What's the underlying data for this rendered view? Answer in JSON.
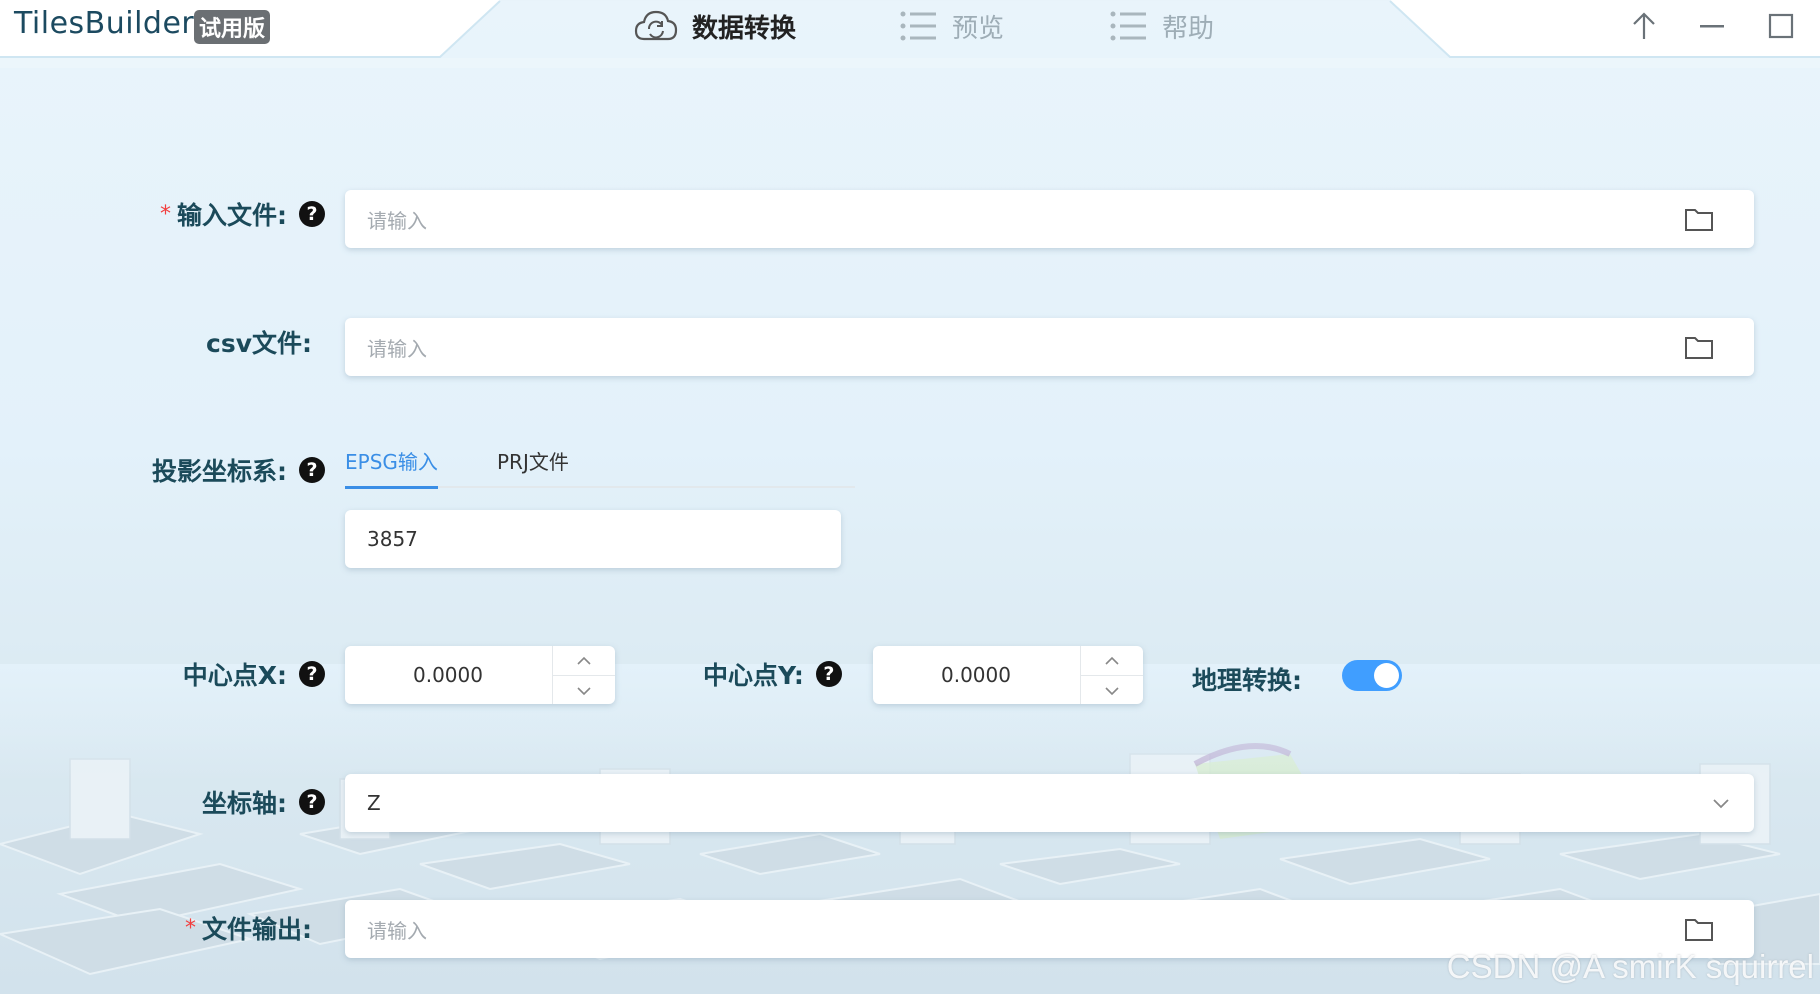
{
  "app": {
    "name": "TilesBuilder",
    "badge": "试用版"
  },
  "nav": [
    {
      "label": "数据转换",
      "icon": "cloud-sync-icon",
      "active": true
    },
    {
      "label": "预览",
      "icon": "list-icon",
      "active": false
    },
    {
      "label": "帮助",
      "icon": "list-icon",
      "active": false
    }
  ],
  "window_controls": [
    "pin-icon",
    "minimize-icon",
    "maximize-icon"
  ],
  "form": {
    "input_file": {
      "label": "输入文件:",
      "required": true,
      "placeholder": "请输入"
    },
    "csv_file": {
      "label": "csv文件:",
      "placeholder": "请输入"
    },
    "projection": {
      "label": "投影坐标系:",
      "tabs": [
        "EPSG输入",
        "PRJ文件"
      ],
      "active_tab": "EPSG输入",
      "value": "3857"
    },
    "center_x": {
      "label": "中心点X:",
      "value": "0.0000"
    },
    "center_y": {
      "label": "中心点Y:",
      "value": "0.0000"
    },
    "geo_transform": {
      "label": "地理转换:",
      "enabled": true
    },
    "axis": {
      "label": "坐标轴:",
      "value": "Z"
    },
    "output_file": {
      "label": "文件输出:",
      "required": true,
      "placeholder": "请输入"
    }
  },
  "help_glyph": "?",
  "required_glyph": "*",
  "watermark": "CSDN @A smirK squirrel",
  "colors": {
    "accent": "#409eff",
    "label": "#1b4a5a",
    "required": "#f23e3e"
  }
}
